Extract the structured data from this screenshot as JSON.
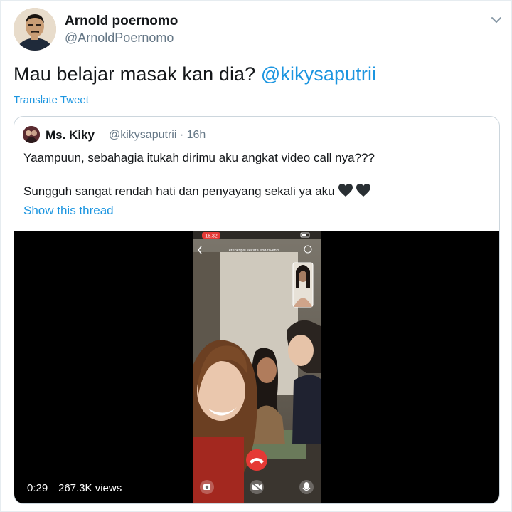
{
  "tweet": {
    "author_name": "Arnold poernomo",
    "author_handle": "@ArnoldPoernomo",
    "text": "Mau belajar masak kan dia? ",
    "mention": "@kikysaputrii",
    "translate_label": "Translate Tweet"
  },
  "quote": {
    "author_name": "Ms. Kiky",
    "author_handle": "@kikysaputrii · 16h",
    "line1": "Yaampuun, sebahagia itukah dirimu aku angkat video call nya???",
    "line2": "Sungguh sangat rendah hati dan penyayang sekali ya aku",
    "show_thread_label": "Show this thread",
    "video": {
      "status_time": "16.32",
      "banner": "Terenkripsi secara end-to-end",
      "duration": "0:29",
      "views": "267.3K views"
    }
  },
  "colors": {
    "link": "#1b95e0",
    "secondary_text": "#657786",
    "border": "#ccd6dd",
    "end_call": "#e53935"
  }
}
